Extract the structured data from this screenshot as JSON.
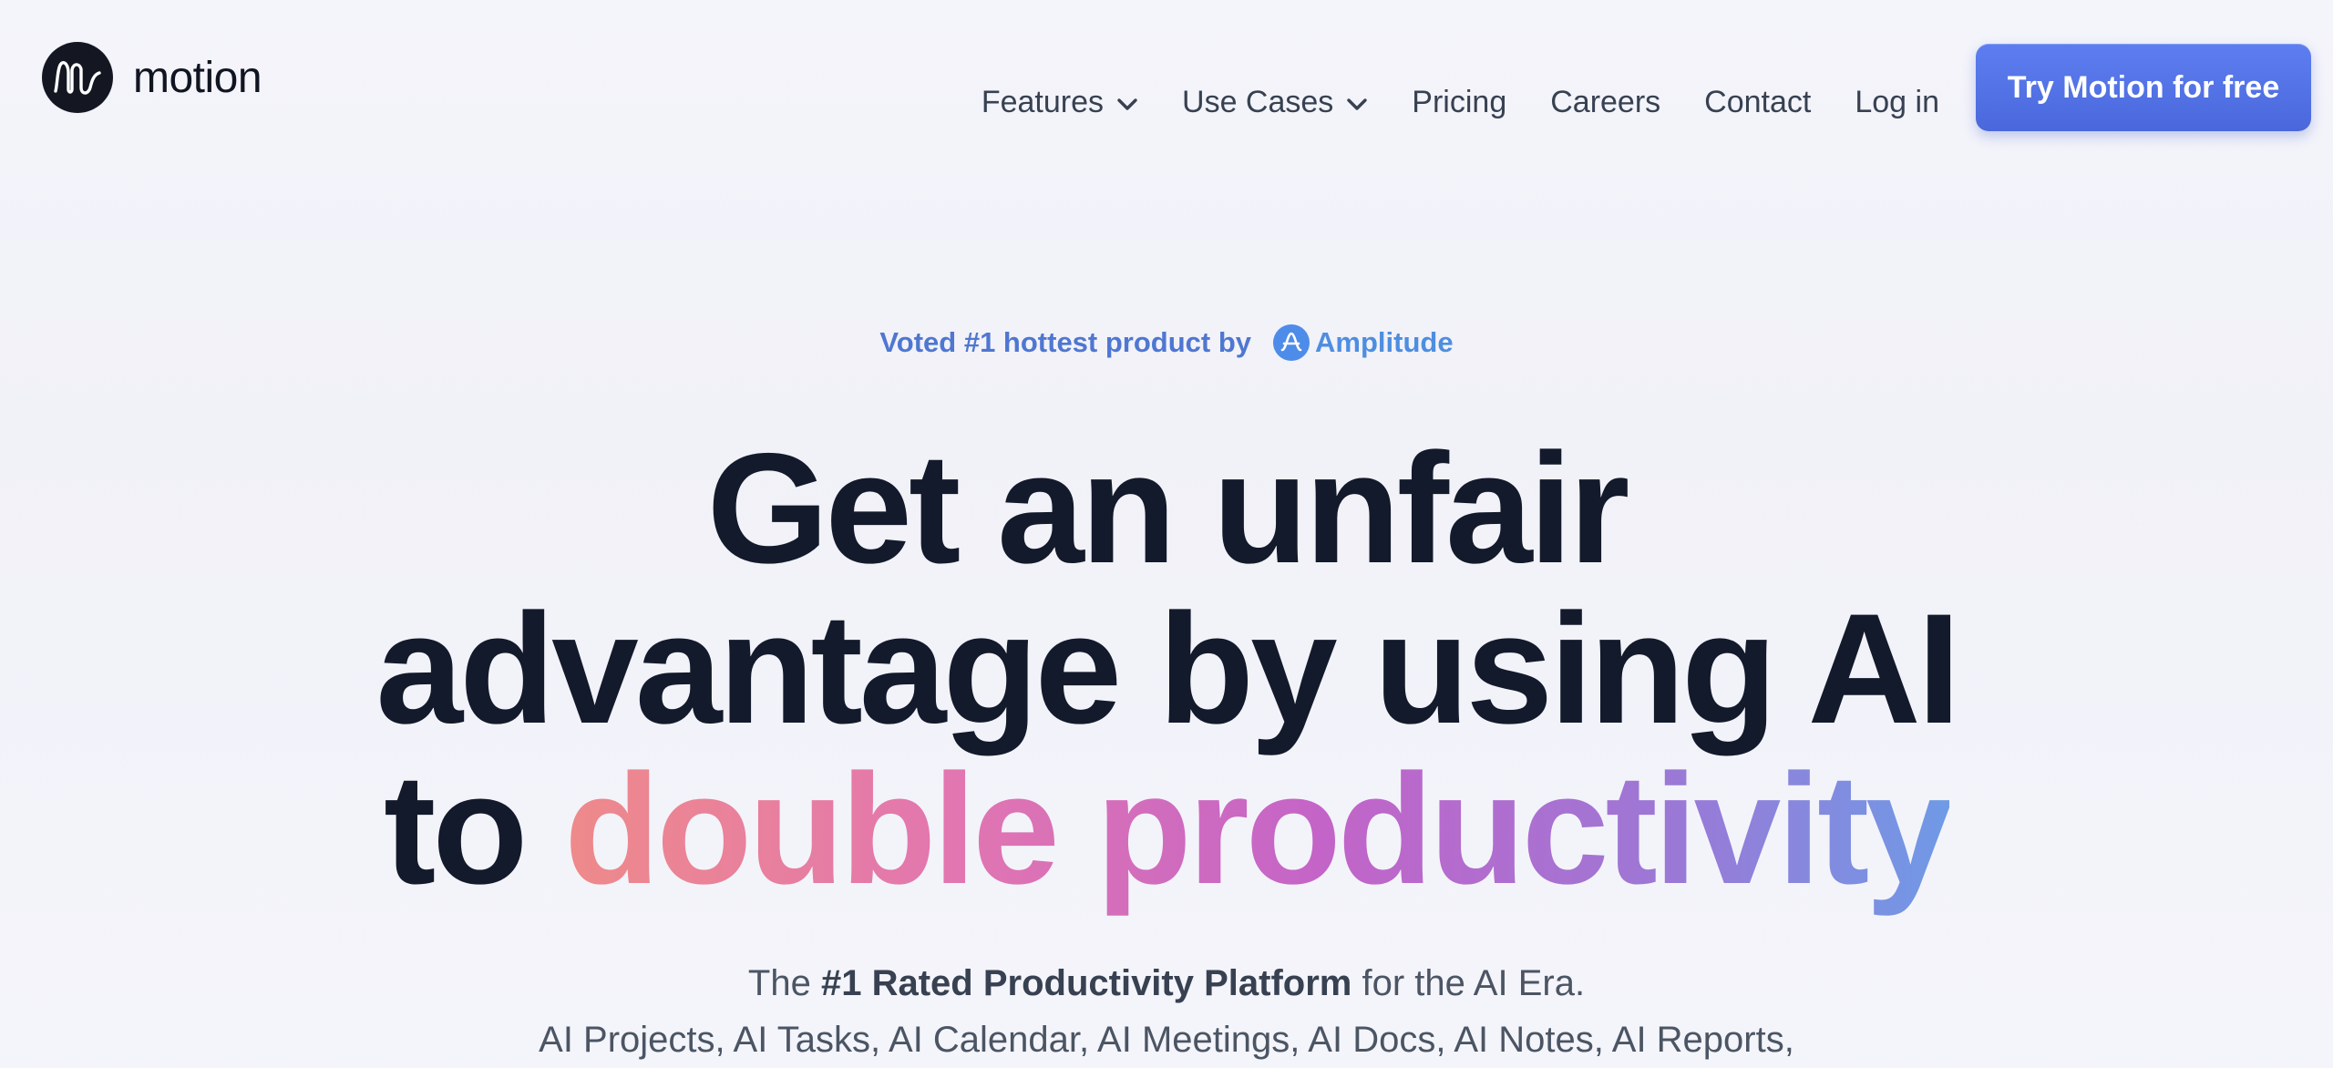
{
  "brand": {
    "name": "motion",
    "logo_icon": "motion-wave-logo",
    "logo_bg": "#141722"
  },
  "nav": {
    "items": [
      {
        "label": "Features",
        "has_dropdown": true,
        "icon": "chevron-down-icon"
      },
      {
        "label": "Use Cases",
        "has_dropdown": true,
        "icon": "chevron-down-icon"
      },
      {
        "label": "Pricing",
        "has_dropdown": false
      },
      {
        "label": "Careers",
        "has_dropdown": false
      },
      {
        "label": "Contact",
        "has_dropdown": false
      },
      {
        "label": "Log in",
        "has_dropdown": false
      }
    ],
    "cta_label": "Try Motion for free",
    "cta_color": "#4f6fe3"
  },
  "hero": {
    "eyebrow_text": "Voted #1 hottest product by",
    "eyebrow_brand": "Amplitude",
    "eyebrow_brand_icon": "amplitude-logo-icon",
    "eyebrow_color": "#4f77d1",
    "headline_line1": "Get an unfair",
    "headline_line2": "advantage by using AI",
    "headline_line3_prefix": "to",
    "headline_line3_highlight": "double productivity",
    "headline_color": "#131a2b",
    "subtitle_prefix": "The",
    "subtitle_bold": "#1 Rated Productivity Platform",
    "subtitle_suffix": "for the AI Era.",
    "subtitle_line2": "AI Projects, AI Tasks, AI Calendar, AI Meetings, AI Docs, AI Notes, AI Reports,"
  }
}
